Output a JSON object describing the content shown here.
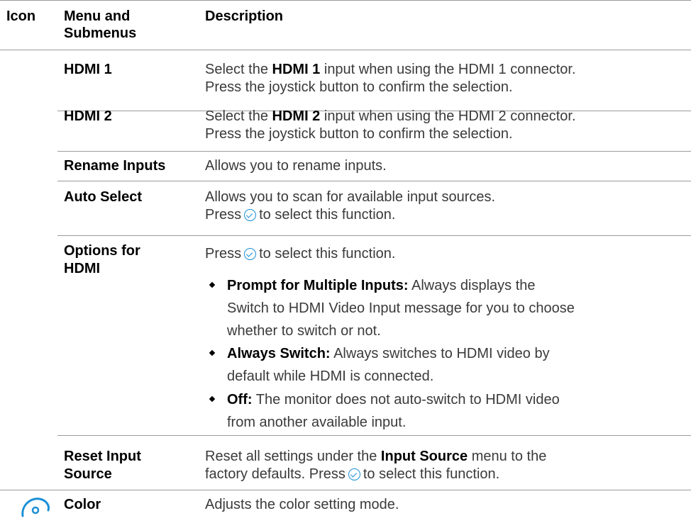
{
  "header": {
    "icon": "Icon",
    "menu_line1": "Menu and",
    "menu_line2": "Submenus",
    "description": "Description"
  },
  "rows": {
    "hdmi1": {
      "name": "HDMI 1",
      "d1_pre": "Select the ",
      "d1_bold": "HDMI 1",
      "d1_post": " input when using the HDMI 1 connector.",
      "d2": "Press the joystick button to confirm the selection."
    },
    "hdmi2": {
      "name": "HDMI 2",
      "d1_pre": "Select the ",
      "d1_bold": "HDMI 2",
      "d1_post": " input when using the HDMI 2 connector.",
      "d2": "Press the joystick button to confirm the selection."
    },
    "rename": {
      "name": "Rename Inputs",
      "d1": "Allows you to rename inputs."
    },
    "auto": {
      "name": "Auto Select",
      "d1": "Allows you to scan for available input sources.",
      "d2_pre": "Press",
      "d2_post": "to select this function."
    },
    "options": {
      "name_line1": "Options for",
      "name_line2": "HDMI",
      "d1_pre": "Press",
      "d1_post": "to select this function.",
      "b1_bold": "Prompt for Multiple Inputs:",
      "b1_l1": " Always displays the",
      "b1_l2": "Switch to HDMI Video Input message for you to choose",
      "b1_l3": "whether to switch or not.",
      "b2_bold": "Always Switch:",
      "b2_l1": " Always switches to HDMI video by",
      "b2_l2": "default while HDMI is connected.",
      "b3_bold": "Off:",
      "b3_l1": " The monitor does not auto-switch to HDMI video",
      "b3_l2": "from another available input."
    },
    "reset": {
      "name_line1": "Reset Input",
      "name_line2": "Source",
      "d1_pre": "Reset all settings under the ",
      "d1_bold": "Input Source",
      "d1_post": " menu to the",
      "d2_pre": "factory defaults. Press",
      "d2_post": "to select this function."
    },
    "color": {
      "name": "Color",
      "d1": "Adjusts the color setting mode."
    }
  },
  "icons": {
    "check": "check-circle-icon",
    "color": "color-palette-icon",
    "accent": "#1a8fd6"
  }
}
